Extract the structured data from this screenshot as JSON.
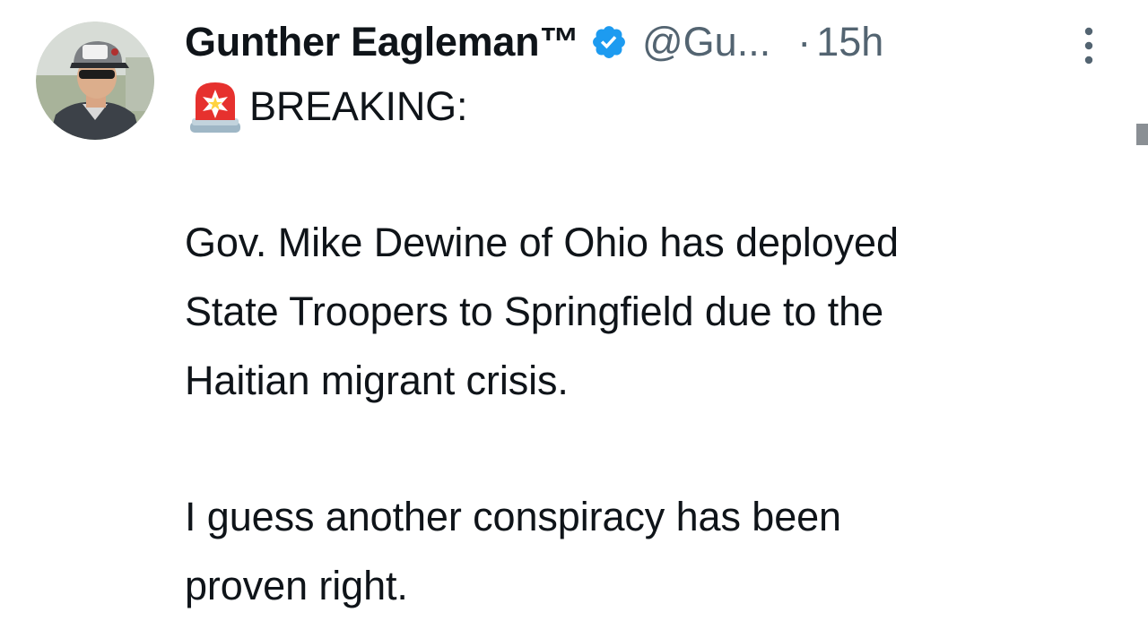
{
  "tweet": {
    "display_name": "Gunther Eagleman™",
    "handle": "@Gu...",
    "separator": "·",
    "time": "15h",
    "avatar_icon": "profile-photo",
    "verified_icon": "verified-badge-icon",
    "more_icon": "more-options-icon",
    "lines": [
      {
        "icon": "police-siren-emoji",
        "text": "BREAKING:"
      }
    ],
    "paragraph1": [
      "Gov. Mike Dewine of Ohio has deployed",
      "State Troopers to Springfield due to the",
      "Haitian migrant crisis."
    ],
    "paragraph2": [
      "I guess another conspiracy has been",
      "proven right."
    ]
  },
  "colors": {
    "verified": "#1d9bf0",
    "text": "#0f1419",
    "secondary": "#536471"
  }
}
